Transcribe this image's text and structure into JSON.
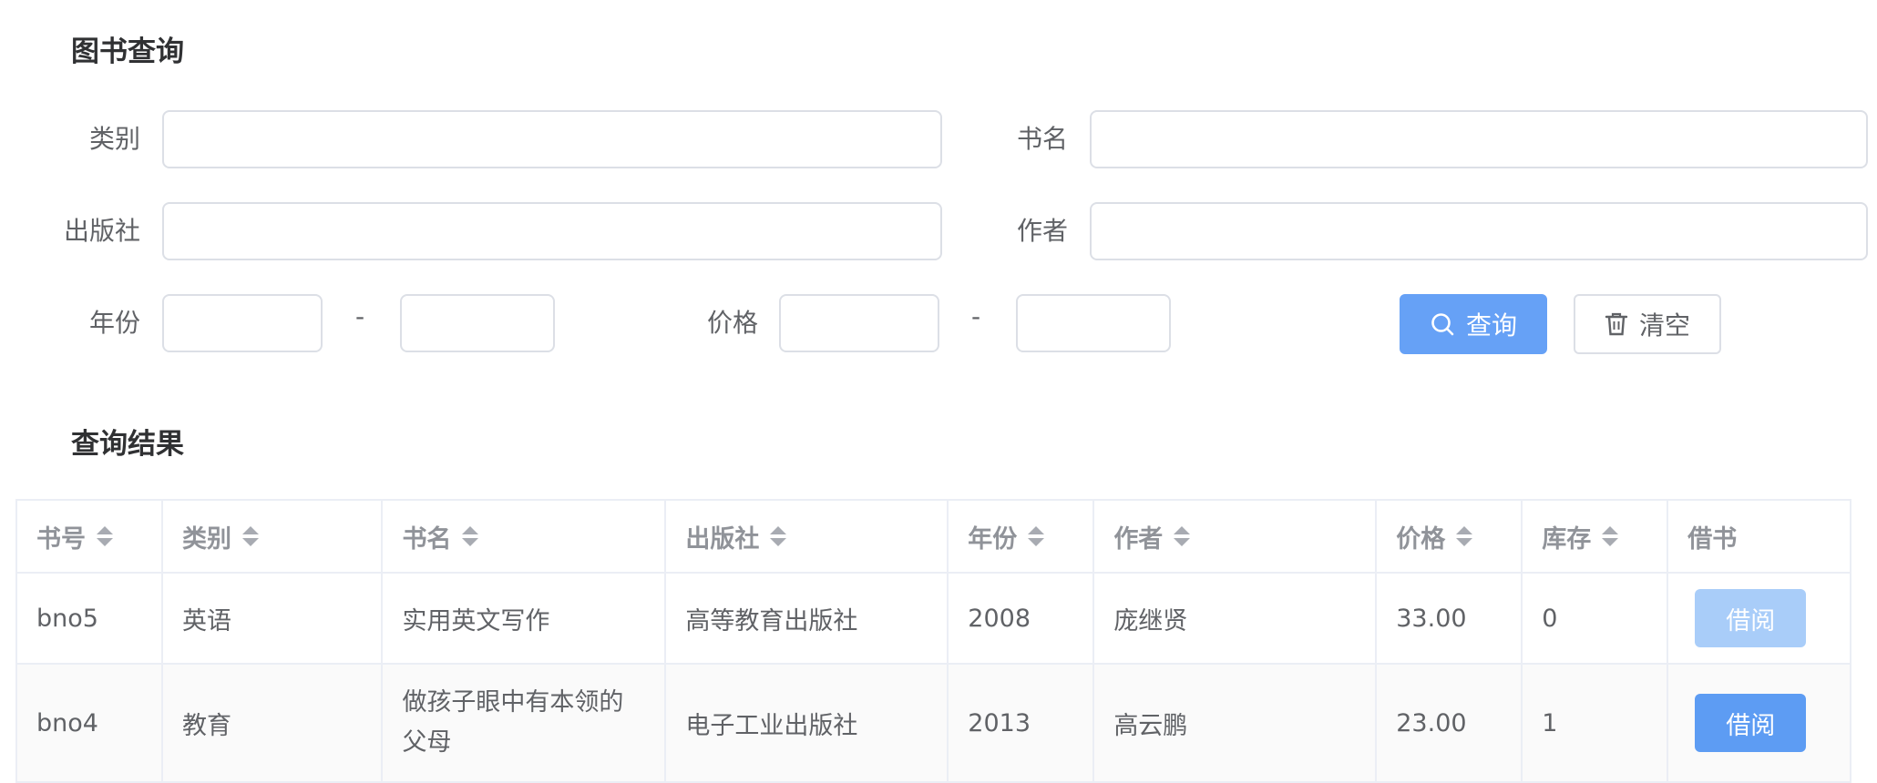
{
  "query_section": {
    "title": "图书查询",
    "labels": {
      "category": "类别",
      "book_name": "书名",
      "publisher": "出版社",
      "author": "作者",
      "year": "年份",
      "price": "价格",
      "range_separator": "-"
    },
    "inputs": {
      "category": "",
      "book_name": "",
      "publisher": "",
      "author": "",
      "year_from": "",
      "year_to": "",
      "price_from": "",
      "price_to": ""
    },
    "buttons": {
      "search": "查询",
      "clear": "清空"
    },
    "icons": {
      "search": "search-icon",
      "clear": "trash-icon"
    }
  },
  "results_section": {
    "title": "查询结果",
    "columns": [
      "书号",
      "类别",
      "书名",
      "出版社",
      "年份",
      "作者",
      "价格",
      "库存",
      "借书"
    ],
    "sortable": [
      true,
      true,
      true,
      true,
      true,
      true,
      true,
      true,
      false
    ],
    "rows": [
      {
        "bno": "bno5",
        "category": "英语",
        "title": "实用英文写作",
        "press": "高等教育出版社",
        "year": "2008",
        "author": "庞继贤",
        "price": "33.00",
        "stock": "0",
        "action": "借阅",
        "action_enabled": false
      },
      {
        "bno": "bno4",
        "category": "教育",
        "title": "做孩子眼中有本领的父母",
        "press": "电子工业出版社",
        "year": "2013",
        "author": "高云鹏",
        "price": "23.00",
        "stock": "1",
        "action": "借阅",
        "action_enabled": true
      }
    ]
  },
  "colors": {
    "primary": "#66a1f6",
    "primary_disabled": "#a9cdf9",
    "border": "#dcdfe6",
    "header_text": "#909399"
  }
}
